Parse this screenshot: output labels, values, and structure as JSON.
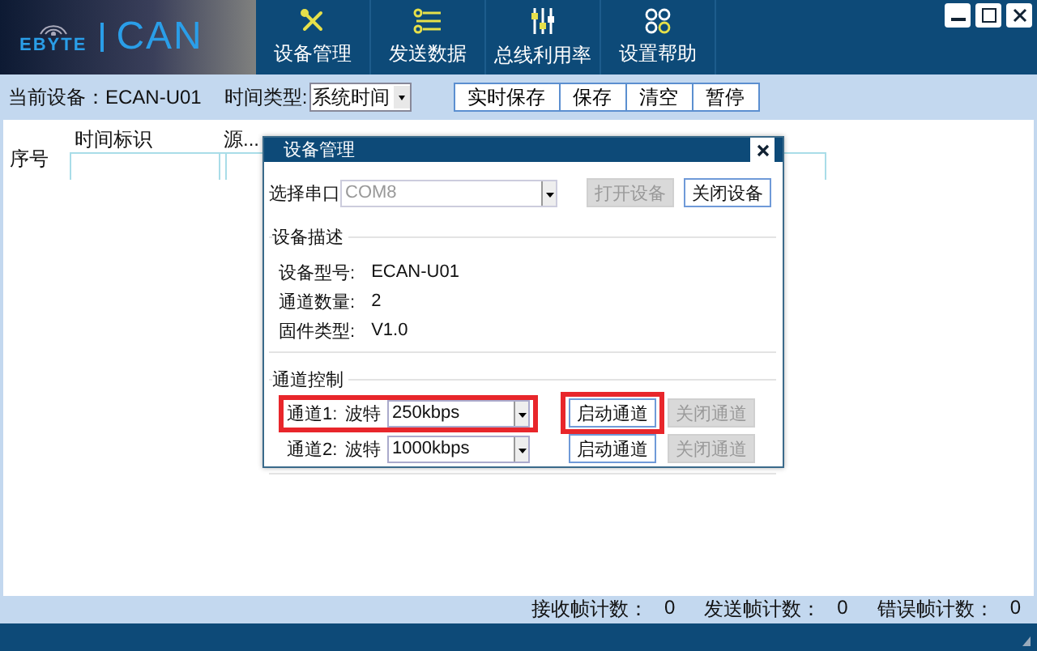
{
  "header": {
    "logo": {
      "brand": "EBYTE",
      "product": "CAN"
    },
    "nav": [
      {
        "label": "设备管理"
      },
      {
        "label": "发送数据"
      },
      {
        "label": "总线利用率"
      },
      {
        "label": "设置帮助"
      }
    ]
  },
  "toolbar": {
    "device_label": "当前设备：",
    "device": "ECAN-U01",
    "time_type_label": "时间类型:",
    "time_type": "系统时间",
    "buttons": [
      "实时保存",
      "保存",
      "清空",
      "暂停"
    ]
  },
  "table": {
    "columns": [
      "序号",
      "时间标识",
      "源..."
    ]
  },
  "dialog": {
    "title": "设备管理",
    "port_label": "选择串口",
    "port": "COM8",
    "port_disabled": true,
    "buttons": [
      {
        "label": "打开设备",
        "disabled": true
      },
      {
        "label": "关闭设备",
        "disabled": false
      }
    ],
    "description": {
      "title": "设备描述",
      "rows": [
        {
          "label": "设备型号:",
          "value": "ECAN-U01"
        },
        {
          "label": "通道数量:",
          "value": "2"
        },
        {
          "label": "固件类型:",
          "value": "V1.0"
        }
      ]
    },
    "channel_control": {
      "title": "通道控制",
      "channels": [
        {
          "name": "通道1:",
          "baud_label": "波特",
          "baud": "250kbps",
          "start": {
            "label": "启动通道",
            "disabled": false
          },
          "stop": {
            "label": "关闭通道",
            "disabled": true
          },
          "row_highlighted": true,
          "start_highlighted": true
        },
        {
          "name": "通道2:",
          "baud_label": "波特",
          "baud": "1000kbps",
          "start": {
            "label": "启动通道",
            "disabled": false
          },
          "stop": {
            "label": "关闭通道",
            "disabled": true
          },
          "row_highlighted": false,
          "start_highlighted": false
        }
      ]
    }
  },
  "status_bar": {
    "counters": [
      {
        "label": "接收帧计数：",
        "value": "0"
      },
      {
        "label": "发送帧计数：",
        "value": "0"
      },
      {
        "label": "错误帧计数：",
        "value": "0"
      }
    ]
  }
}
